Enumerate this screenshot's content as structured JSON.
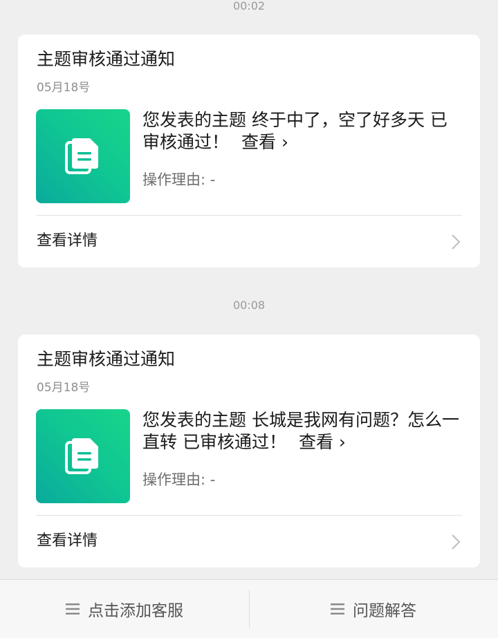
{
  "timestamps": [
    "00:02",
    "00:08"
  ],
  "cards": [
    {
      "title": "主题审核通过通知",
      "date": "05月18号",
      "message": "您发表的主题 终于中了，空了好多天 已审核通过！",
      "view_link": "查看 ›",
      "reason": "操作理由: -",
      "details_label": "查看详情",
      "thumb_icon": "document-icon"
    },
    {
      "title": "主题审核通过通知",
      "date": "05月18号",
      "message": "您发表的主题 长城是我网有问题？怎么一直转 已审核通过！",
      "view_link": "查看 ›",
      "reason": "操作理由: -",
      "details_label": "查看详情",
      "thumb_icon": "document-icon"
    }
  ],
  "bottom_bar": {
    "items": [
      {
        "label": "点击添加客服",
        "icon": "menu-icon"
      },
      {
        "label": "问题解答",
        "icon": "menu-icon"
      }
    ]
  },
  "colors": {
    "background": "#efefef",
    "card": "#ffffff",
    "accent_start": "#0aaa9c",
    "accent_end": "#18d48a"
  }
}
